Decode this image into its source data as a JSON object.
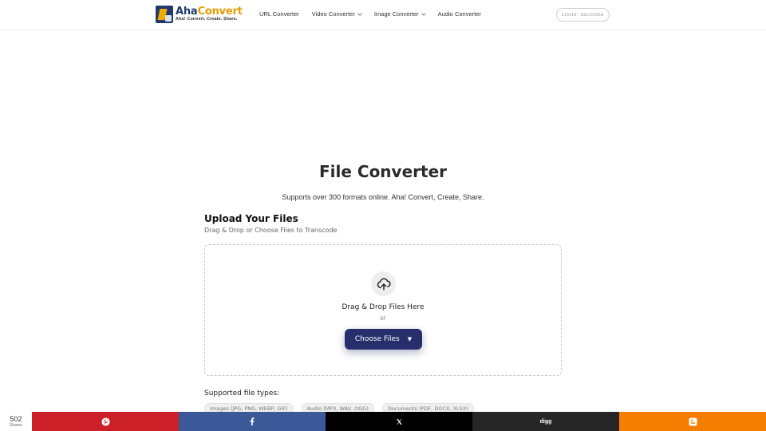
{
  "header": {
    "logo": {
      "brand_part1": "Aha",
      "brand_part2": "Convert",
      "tagline": "Aha! Convert. Create. Share."
    },
    "nav": [
      {
        "label": "URL Converter",
        "has_dropdown": false
      },
      {
        "label": "Video Converter",
        "has_dropdown": true
      },
      {
        "label": "Image Converter",
        "has_dropdown": true
      },
      {
        "label": "Audio Converter",
        "has_dropdown": false
      }
    ],
    "login_label": "LOGIN / REGISTER"
  },
  "hero": {
    "title": "File Converter",
    "subtitle": "Supports over 300 formats online. Aha! Convert, Create, Share."
  },
  "upload": {
    "heading": "Upload Your Files",
    "subheading": "Drag & Drop or Choose Files to Transcode",
    "drop_text": "Drag & Drop Files Here",
    "or_text": "or",
    "choose_label": "Choose Files",
    "caret": "▼",
    "icon": "cloud-upload-icon"
  },
  "supported": {
    "heading": "Supported file types:",
    "types": [
      "Images (JPG, PNG, WEBP, GIF)",
      "Audio (MP3, WAV, OGG)",
      "Documents (PDF, DOCX, XLSX)"
    ]
  },
  "share": {
    "count": "502",
    "count_label": "Shares",
    "digg_label": "digg",
    "colors": {
      "pinterest": "#cb2027",
      "facebook": "#3b5998",
      "x": "#000000",
      "digg": "#262626",
      "blogger": "#f57d00"
    }
  },
  "colors": {
    "brand_navy": "#1f3a6d",
    "brand_orange": "#e39d00",
    "button": "#262f6b"
  }
}
